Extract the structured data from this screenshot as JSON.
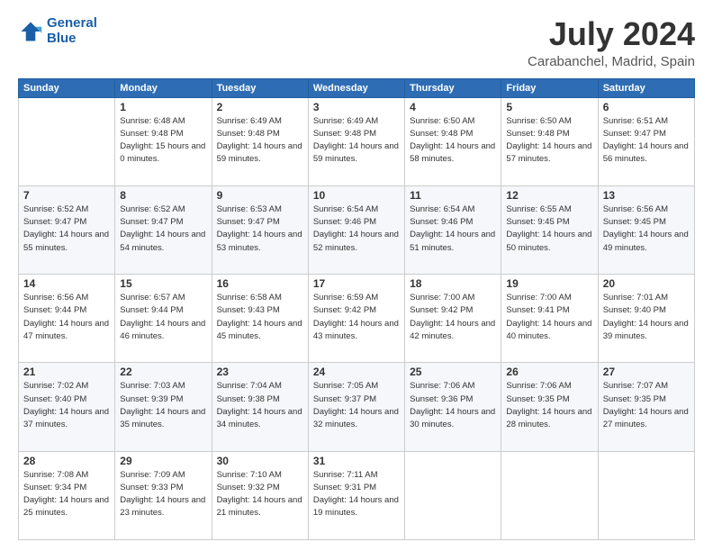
{
  "header": {
    "logo_line1": "General",
    "logo_line2": "Blue",
    "month": "July 2024",
    "location": "Carabanchel, Madrid, Spain"
  },
  "weekdays": [
    "Sunday",
    "Monday",
    "Tuesday",
    "Wednesday",
    "Thursday",
    "Friday",
    "Saturday"
  ],
  "weeks": [
    [
      {
        "day": "",
        "sunrise": "",
        "sunset": "",
        "daylight": ""
      },
      {
        "day": "1",
        "sunrise": "Sunrise: 6:48 AM",
        "sunset": "Sunset: 9:48 PM",
        "daylight": "Daylight: 15 hours and 0 minutes."
      },
      {
        "day": "2",
        "sunrise": "Sunrise: 6:49 AM",
        "sunset": "Sunset: 9:48 PM",
        "daylight": "Daylight: 14 hours and 59 minutes."
      },
      {
        "day": "3",
        "sunrise": "Sunrise: 6:49 AM",
        "sunset": "Sunset: 9:48 PM",
        "daylight": "Daylight: 14 hours and 59 minutes."
      },
      {
        "day": "4",
        "sunrise": "Sunrise: 6:50 AM",
        "sunset": "Sunset: 9:48 PM",
        "daylight": "Daylight: 14 hours and 58 minutes."
      },
      {
        "day": "5",
        "sunrise": "Sunrise: 6:50 AM",
        "sunset": "Sunset: 9:48 PM",
        "daylight": "Daylight: 14 hours and 57 minutes."
      },
      {
        "day": "6",
        "sunrise": "Sunrise: 6:51 AM",
        "sunset": "Sunset: 9:47 PM",
        "daylight": "Daylight: 14 hours and 56 minutes."
      }
    ],
    [
      {
        "day": "7",
        "sunrise": "Sunrise: 6:52 AM",
        "sunset": "Sunset: 9:47 PM",
        "daylight": "Daylight: 14 hours and 55 minutes."
      },
      {
        "day": "8",
        "sunrise": "Sunrise: 6:52 AM",
        "sunset": "Sunset: 9:47 PM",
        "daylight": "Daylight: 14 hours and 54 minutes."
      },
      {
        "day": "9",
        "sunrise": "Sunrise: 6:53 AM",
        "sunset": "Sunset: 9:47 PM",
        "daylight": "Daylight: 14 hours and 53 minutes."
      },
      {
        "day": "10",
        "sunrise": "Sunrise: 6:54 AM",
        "sunset": "Sunset: 9:46 PM",
        "daylight": "Daylight: 14 hours and 52 minutes."
      },
      {
        "day": "11",
        "sunrise": "Sunrise: 6:54 AM",
        "sunset": "Sunset: 9:46 PM",
        "daylight": "Daylight: 14 hours and 51 minutes."
      },
      {
        "day": "12",
        "sunrise": "Sunrise: 6:55 AM",
        "sunset": "Sunset: 9:45 PM",
        "daylight": "Daylight: 14 hours and 50 minutes."
      },
      {
        "day": "13",
        "sunrise": "Sunrise: 6:56 AM",
        "sunset": "Sunset: 9:45 PM",
        "daylight": "Daylight: 14 hours and 49 minutes."
      }
    ],
    [
      {
        "day": "14",
        "sunrise": "Sunrise: 6:56 AM",
        "sunset": "Sunset: 9:44 PM",
        "daylight": "Daylight: 14 hours and 47 minutes."
      },
      {
        "day": "15",
        "sunrise": "Sunrise: 6:57 AM",
        "sunset": "Sunset: 9:44 PM",
        "daylight": "Daylight: 14 hours and 46 minutes."
      },
      {
        "day": "16",
        "sunrise": "Sunrise: 6:58 AM",
        "sunset": "Sunset: 9:43 PM",
        "daylight": "Daylight: 14 hours and 45 minutes."
      },
      {
        "day": "17",
        "sunrise": "Sunrise: 6:59 AM",
        "sunset": "Sunset: 9:42 PM",
        "daylight": "Daylight: 14 hours and 43 minutes."
      },
      {
        "day": "18",
        "sunrise": "Sunrise: 7:00 AM",
        "sunset": "Sunset: 9:42 PM",
        "daylight": "Daylight: 14 hours and 42 minutes."
      },
      {
        "day": "19",
        "sunrise": "Sunrise: 7:00 AM",
        "sunset": "Sunset: 9:41 PM",
        "daylight": "Daylight: 14 hours and 40 minutes."
      },
      {
        "day": "20",
        "sunrise": "Sunrise: 7:01 AM",
        "sunset": "Sunset: 9:40 PM",
        "daylight": "Daylight: 14 hours and 39 minutes."
      }
    ],
    [
      {
        "day": "21",
        "sunrise": "Sunrise: 7:02 AM",
        "sunset": "Sunset: 9:40 PM",
        "daylight": "Daylight: 14 hours and 37 minutes."
      },
      {
        "day": "22",
        "sunrise": "Sunrise: 7:03 AM",
        "sunset": "Sunset: 9:39 PM",
        "daylight": "Daylight: 14 hours and 35 minutes."
      },
      {
        "day": "23",
        "sunrise": "Sunrise: 7:04 AM",
        "sunset": "Sunset: 9:38 PM",
        "daylight": "Daylight: 14 hours and 34 minutes."
      },
      {
        "day": "24",
        "sunrise": "Sunrise: 7:05 AM",
        "sunset": "Sunset: 9:37 PM",
        "daylight": "Daylight: 14 hours and 32 minutes."
      },
      {
        "day": "25",
        "sunrise": "Sunrise: 7:06 AM",
        "sunset": "Sunset: 9:36 PM",
        "daylight": "Daylight: 14 hours and 30 minutes."
      },
      {
        "day": "26",
        "sunrise": "Sunrise: 7:06 AM",
        "sunset": "Sunset: 9:35 PM",
        "daylight": "Daylight: 14 hours and 28 minutes."
      },
      {
        "day": "27",
        "sunrise": "Sunrise: 7:07 AM",
        "sunset": "Sunset: 9:35 PM",
        "daylight": "Daylight: 14 hours and 27 minutes."
      }
    ],
    [
      {
        "day": "28",
        "sunrise": "Sunrise: 7:08 AM",
        "sunset": "Sunset: 9:34 PM",
        "daylight": "Daylight: 14 hours and 25 minutes."
      },
      {
        "day": "29",
        "sunrise": "Sunrise: 7:09 AM",
        "sunset": "Sunset: 9:33 PM",
        "daylight": "Daylight: 14 hours and 23 minutes."
      },
      {
        "day": "30",
        "sunrise": "Sunrise: 7:10 AM",
        "sunset": "Sunset: 9:32 PM",
        "daylight": "Daylight: 14 hours and 21 minutes."
      },
      {
        "day": "31",
        "sunrise": "Sunrise: 7:11 AM",
        "sunset": "Sunset: 9:31 PM",
        "daylight": "Daylight: 14 hours and 19 minutes."
      },
      {
        "day": "",
        "sunrise": "",
        "sunset": "",
        "daylight": ""
      },
      {
        "day": "",
        "sunrise": "",
        "sunset": "",
        "daylight": ""
      },
      {
        "day": "",
        "sunrise": "",
        "sunset": "",
        "daylight": ""
      }
    ]
  ]
}
